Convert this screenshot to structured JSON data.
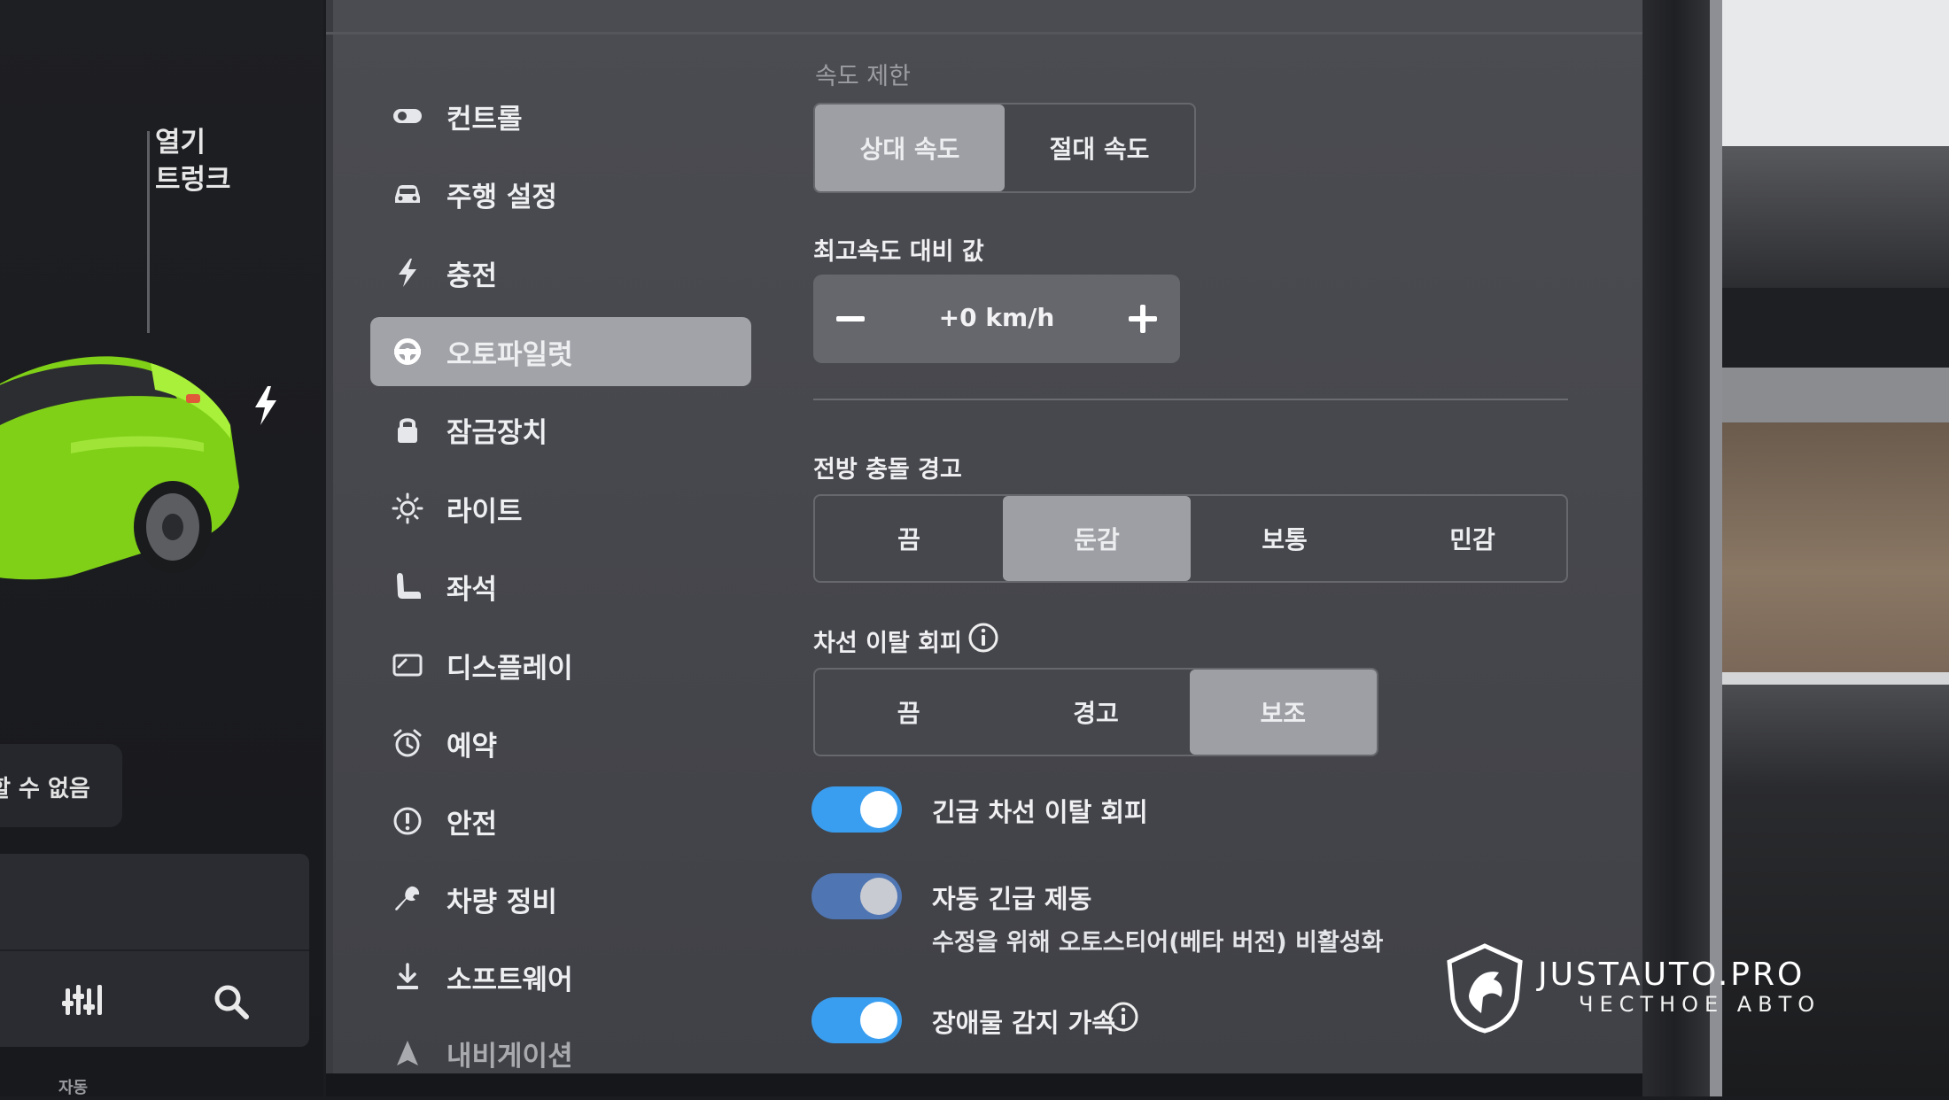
{
  "left_panel": {
    "trunk_label_line1": "열기",
    "trunk_label_line2": "트렁크",
    "unavailable_text": "할 수 없음",
    "footer_text": "자동",
    "car_color": "#8fe21f"
  },
  "menu": {
    "items": [
      {
        "label": "컨트롤",
        "icon": "toggle-icon"
      },
      {
        "label": "주행 설정",
        "icon": "car-icon"
      },
      {
        "label": "충전",
        "icon": "bolt-icon"
      },
      {
        "label": "오토파일럿",
        "icon": "steering-wheel-icon",
        "active": true
      },
      {
        "label": "잠금장치",
        "icon": "lock-icon"
      },
      {
        "label": "라이트",
        "icon": "sun-icon"
      },
      {
        "label": "좌석",
        "icon": "seat-icon"
      },
      {
        "label": "디스플레이",
        "icon": "display-icon"
      },
      {
        "label": "예약",
        "icon": "alarm-clock-icon"
      },
      {
        "label": "안전",
        "icon": "warning-icon"
      },
      {
        "label": "차량 정비",
        "icon": "wrench-icon"
      },
      {
        "label": "소프트웨어",
        "icon": "download-icon"
      },
      {
        "label": "내비게이션",
        "icon": "navigation-icon"
      }
    ],
    "footer_text": "자동"
  },
  "speed_limit": {
    "title": "속도 제한",
    "options": [
      "상대 속도",
      "절대 속도"
    ],
    "selected": "상대 속도"
  },
  "offset": {
    "title": "최고속도 대비 값",
    "value": "+0 km/h"
  },
  "forward_collision": {
    "title": "전방 충돌 경고",
    "options": [
      "끔",
      "둔감",
      "보통",
      "민감"
    ],
    "selected": "둔감"
  },
  "lane_departure": {
    "title": "차선 이탈 회피",
    "options": [
      "끔",
      "경고",
      "보조"
    ],
    "selected": "보조"
  },
  "toggles": {
    "emergency_lane": {
      "label": "긴급 차선 이탈 회피",
      "on": true
    },
    "auto_emergency_braking": {
      "label": "자동 긴급 제동",
      "sub": "수정을 위해 오토스티어(베타 버전) 비활성화",
      "on": true,
      "disabled": true
    },
    "obstacle_accel": {
      "label": "장애물 감지 가속",
      "on": true
    }
  },
  "watermark": {
    "brand": "JUSTAUTO.PRO",
    "tagline": "ЧЕСТНОЕ АВТО"
  },
  "colors": {
    "accent_toggle": "#3a9ef0",
    "selected_segment": "#9e9fa4",
    "active_menu": "#a2a3a8"
  }
}
